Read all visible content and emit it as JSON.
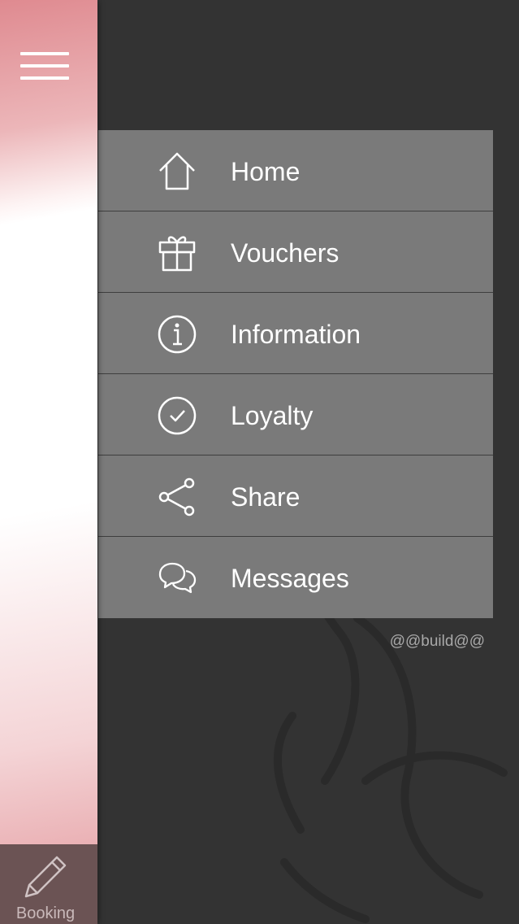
{
  "menu": {
    "items": [
      {
        "label": "Home",
        "icon": "home-icon"
      },
      {
        "label": "Vouchers",
        "icon": "gift-icon"
      },
      {
        "label": "Information",
        "icon": "info-icon"
      },
      {
        "label": "Loyalty",
        "icon": "check-circle-icon"
      },
      {
        "label": "Share",
        "icon": "share-icon"
      },
      {
        "label": "Messages",
        "icon": "chat-bubbles-icon"
      }
    ]
  },
  "build_label": "@@build@@",
  "sidebar": {
    "booking_label": "Booking"
  },
  "colors": {
    "background": "#333333",
    "menu_background": "#7a7a7a",
    "accent_pink": "#df8a90",
    "booking_background": "#6b5354"
  }
}
